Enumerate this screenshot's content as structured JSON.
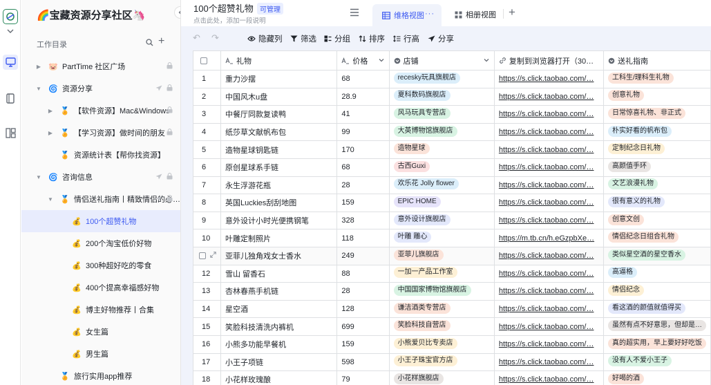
{
  "sidebar": {
    "title": "🌈宝藏资源分享社区🦄",
    "section_label": "工作目录",
    "items": [
      {
        "label": "PartTime 社区广场",
        "level": 0,
        "expand": "▶",
        "icon": "🐷",
        "right": "lock"
      },
      {
        "label": "资源分享",
        "level": 0,
        "expand": "▼",
        "icon": "🌀",
        "right": "lock-send"
      },
      {
        "label": "【软件资源】Mac&Windows",
        "level": 1,
        "expand": "▶",
        "icon": "🏅",
        "right": "lock"
      },
      {
        "label": "【学习资源】做时间的朋友",
        "level": 1,
        "expand": "▶",
        "icon": "🏅",
        "right": "lock"
      },
      {
        "label": "资源统计表【帮你找资源】",
        "level": 1,
        "expand": "",
        "icon": "🏅",
        "right": ""
      },
      {
        "label": "咨询信息",
        "level": 0,
        "expand": "▼",
        "icon": "🌀",
        "right": "lock-send"
      },
      {
        "label": "情侣送礼指南丨精致情侣的必…",
        "level": 1,
        "expand": "▼",
        "icon": "🏅",
        "right": "lock-send"
      },
      {
        "label": "100个超赞礼物",
        "level": 2,
        "expand": "",
        "icon": "💰",
        "right": "",
        "active": true
      },
      {
        "label": "200个淘宝低价好物",
        "level": 2,
        "expand": "",
        "icon": "💰",
        "right": ""
      },
      {
        "label": "300种超好吃的零食",
        "level": 2,
        "expand": "",
        "icon": "💰",
        "right": ""
      },
      {
        "label": "400个提高幸福感好物",
        "level": 2,
        "expand": "",
        "icon": "💰",
        "right": ""
      },
      {
        "label": "博主好物推荐丨合集",
        "level": 2,
        "expand": "",
        "icon": "💰",
        "right": ""
      },
      {
        "label": "女生篇",
        "level": 2,
        "expand": "",
        "icon": "💰",
        "right": ""
      },
      {
        "label": "男生篇",
        "level": 2,
        "expand": "",
        "icon": "💰",
        "right": ""
      },
      {
        "label": "旅行实用app推荐",
        "level": 1,
        "expand": "",
        "icon": "🏅",
        "right": ""
      }
    ]
  },
  "header": {
    "title": "100个超赞礼物",
    "badge": "可管理",
    "subtitle": "点击此处，添加一段说明",
    "tab_grid": "维格视图",
    "tab_grid_more": "···",
    "tab_album": "相册视图",
    "tab_add": "+"
  },
  "toolbar": {
    "undo": "↶",
    "redo": "↷",
    "hide": "隐藏列",
    "filter": "筛选",
    "group": "分组",
    "sort": "排序",
    "row_height": "行高",
    "share": "分享"
  },
  "table": {
    "columns": [
      "礼物",
      "价格",
      "店铺",
      "复制到浏览器打开（30…",
      "送礼指南"
    ],
    "rows": [
      {
        "no": "1",
        "gift": "重力沙摆",
        "price": "68",
        "shop": "recesky玩具旗舰店",
        "shop_color": "#dbeefa",
        "link": "https://s.click.taobao.com/…",
        "guide": "工科生/理科生礼物",
        "guide_color": "#fbe3d9"
      },
      {
        "no": "2",
        "gift": "中国风木u盘",
        "price": "28.9",
        "shop": "夏科数码旗舰店",
        "shop_color": "#dbeefa",
        "link": "https://s.click.taobao.com/…",
        "guide": "创意礼物",
        "guide_color": "#fbe3d9"
      },
      {
        "no": "3",
        "gift": "中餐厅同款复读鸭",
        "price": "41",
        "shop": "风马玩具专营店",
        "shop_color": "#d8f3e3",
        "link": "https://s.click.taobao.com/…",
        "guide": "日常惊喜礼物、非正式",
        "guide_color": "#fbe3d9"
      },
      {
        "no": "4",
        "gift": "纸莎草文献帆布包",
        "price": "99",
        "shop": "大英博物馆旗舰店",
        "shop_color": "#d8f3e3",
        "link": "https://s.click.taobao.com/…",
        "guide": "朴实好看的帆布包",
        "guide_color": "#dbeefa"
      },
      {
        "no": "5",
        "gift": "造物星球钥匙链",
        "price": "170",
        "shop": "造物星球",
        "shop_color": "#fbe3d9",
        "link": "https://s.click.taobao.com/…",
        "guide": "定制纪念日礼物",
        "guide_color": "#fdf0d5"
      },
      {
        "no": "6",
        "gift": "原创星球系手链",
        "price": "68",
        "shop": "古西Guxi",
        "shop_color": "#fbe0e0",
        "link": "https://s.click.taobao.com/…",
        "guide": "高颜值手环",
        "guide_color": "#e9e5e3"
      },
      {
        "no": "7",
        "gift": "永生浮游花瓶",
        "price": "28",
        "shop": "欢乐花 Jolly flower",
        "shop_color": "#dbeefa",
        "link": "https://s.click.taobao.com/…",
        "guide": "文艺浪漫礼物",
        "guide_color": "#d8f3e3"
      },
      {
        "no": "8",
        "gift": "英国Luckies刮刮地图",
        "price": "159",
        "shop": "EPIC HOME",
        "shop_color": "#e6e3fa",
        "link": "https://s.click.taobao.com/…",
        "guide": "很有意义的礼物",
        "guide_color": "#e3e8fb"
      },
      {
        "no": "9",
        "gift": "意外设计小时光便携钢笔",
        "price": "328",
        "shop": "意外设计旗舰店",
        "shop_color": "#e3e8fb",
        "link": "https://s.click.taobao.com/…",
        "guide": "创意文创",
        "guide_color": "#fbe3d9"
      },
      {
        "no": "10",
        "gift": "叶雕定制照片",
        "price": "118",
        "shop": "叶雕 雕心",
        "shop_color": "#e3e8fb",
        "link": "https://m.tb.cn/h.eGzpbXe…",
        "guide": "情侣纪念日组合礼物",
        "guide_color": "#fbe3d9"
      },
      {
        "no": "",
        "gift": "亚菲儿独角戏女士香水",
        "price": "249",
        "shop": "亚菲儿旗舰店",
        "shop_color": "#fbe3d9",
        "link": "https://s.click.taobao.com/…",
        "guide": "类似星空酒的星空香水",
        "guide_color": "#d8f3e3",
        "hover": true
      },
      {
        "no": "12",
        "gift": "雪山 留香石",
        "price": "88",
        "shop": "一加一产品工作室",
        "shop_color": "#fdf0d5",
        "link": "https://s.click.taobao.com/…",
        "guide": "高逼格",
        "guide_color": "#dbeefa"
      },
      {
        "no": "13",
        "gift": "杏林春燕手机链",
        "price": "28",
        "shop": "中国国家博物馆旗舰店",
        "shop_color": "#d8f3e3",
        "link": "https://s.click.taobao.com/…",
        "guide": "情侣纪念",
        "guide_color": "#fdf0d5"
      },
      {
        "no": "14",
        "gift": "星空酒",
        "price": "128",
        "shop": "谦洁酒类专营店",
        "shop_color": "#fbe3d9",
        "link": "https://s.click.taobao.com/…",
        "guide": "看这酒的颜值就值得买",
        "guide_color": "#e3e8fb"
      },
      {
        "no": "15",
        "gift": "笑脸科技清洗内裤机",
        "price": "699",
        "shop": "笑脸科技自营店",
        "shop_color": "#fbe3d9",
        "link": "https://s.click.taobao.com/…",
        "guide": "虽然有点不好意思，但却是…",
        "guide_color": "#e9e5e3"
      },
      {
        "no": "16",
        "gift": "小熊多功能早餐机",
        "price": "159",
        "shop": "小熊爱贝比专卖店",
        "shop_color": "#fdf0d5",
        "link": "https://s.click.taobao.com/…",
        "guide": "真的超实用，早上要好好吃饭",
        "guide_color": "#fbe3d9"
      },
      {
        "no": "17",
        "gift": "小王子项链",
        "price": "598",
        "shop": "小王子珠宝官方店",
        "shop_color": "#fdf0d5",
        "link": "https://s.click.taobao.com/…",
        "guide": "没有人不爱小王子",
        "guide_color": "#d8f3e3"
      },
      {
        "no": "18",
        "gift": "小花样玫瑰酿",
        "price": "79",
        "shop": "小花样旗舰店",
        "shop_color": "#e9e5e3",
        "link": "https://s.click.taobao.com/…",
        "guide": "好喝的酒",
        "guide_color": "#fbe3d9"
      }
    ]
  }
}
